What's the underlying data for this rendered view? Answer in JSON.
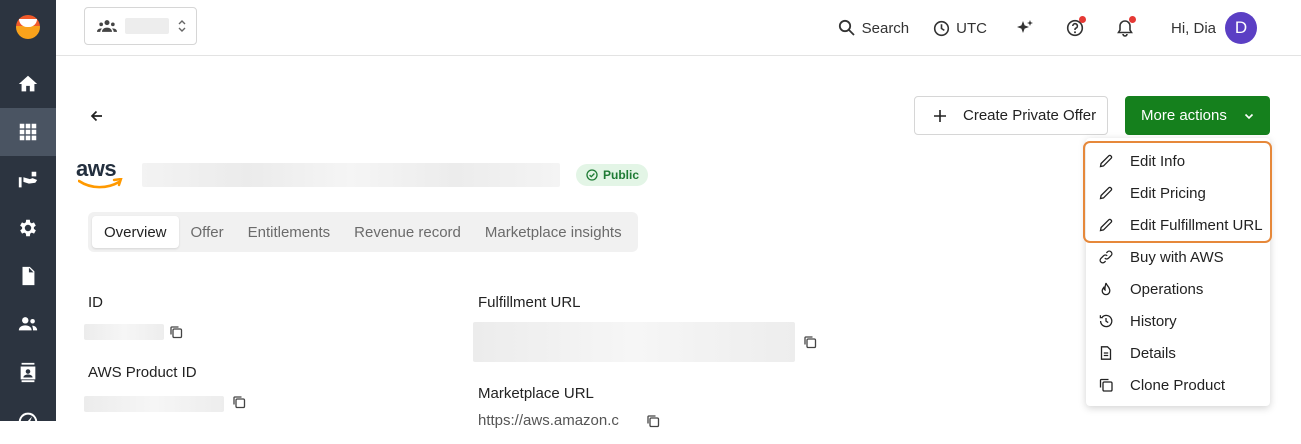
{
  "sidebar": {
    "items": [
      {
        "icon": "home-icon"
      },
      {
        "icon": "grid-icon",
        "active": true
      },
      {
        "icon": "hand-money-icon"
      },
      {
        "icon": "gear-icon"
      },
      {
        "icon": "document-icon"
      },
      {
        "icon": "people-icon"
      },
      {
        "icon": "contact-card-icon"
      },
      {
        "icon": "gauge-icon"
      }
    ]
  },
  "topbar": {
    "search_label": "Search",
    "timezone_label": "UTC",
    "greeting": "Hi, Dia",
    "avatar_initial": "D"
  },
  "header": {
    "create_offer_label": "Create Private Offer",
    "more_actions_label": "More actions",
    "logo_text": "aws",
    "status_badge": "Public"
  },
  "tabs": [
    "Overview",
    "Offer",
    "Entitlements",
    "Revenue record",
    "Marketplace insights"
  ],
  "fields": {
    "id_label": "ID",
    "aws_product_id_label": "AWS Product ID",
    "fulfillment_url_label": "Fulfillment URL",
    "marketplace_url_label": "Marketplace URL",
    "marketplace_url_partial": "https://aws.amazon.c"
  },
  "more_actions_menu": [
    {
      "label": "Edit Info",
      "icon": "pencil-icon"
    },
    {
      "label": "Edit Pricing",
      "icon": "pencil-icon"
    },
    {
      "label": "Edit Fulfillment URL",
      "icon": "pencil-icon"
    },
    {
      "label": "Buy with AWS",
      "icon": "link-icon"
    },
    {
      "label": "Operations",
      "icon": "flame-icon"
    },
    {
      "label": "History",
      "icon": "history-icon"
    },
    {
      "label": "Details",
      "icon": "document-icon"
    },
    {
      "label": "Clone Product",
      "icon": "clone-icon"
    }
  ],
  "colors": {
    "sidebar_bg": "#2c3440",
    "primary_green": "#15801d",
    "highlight_orange": "#e6883a",
    "badge_green_bg": "#e3f5e6",
    "avatar_purple": "#5b3fc4"
  }
}
